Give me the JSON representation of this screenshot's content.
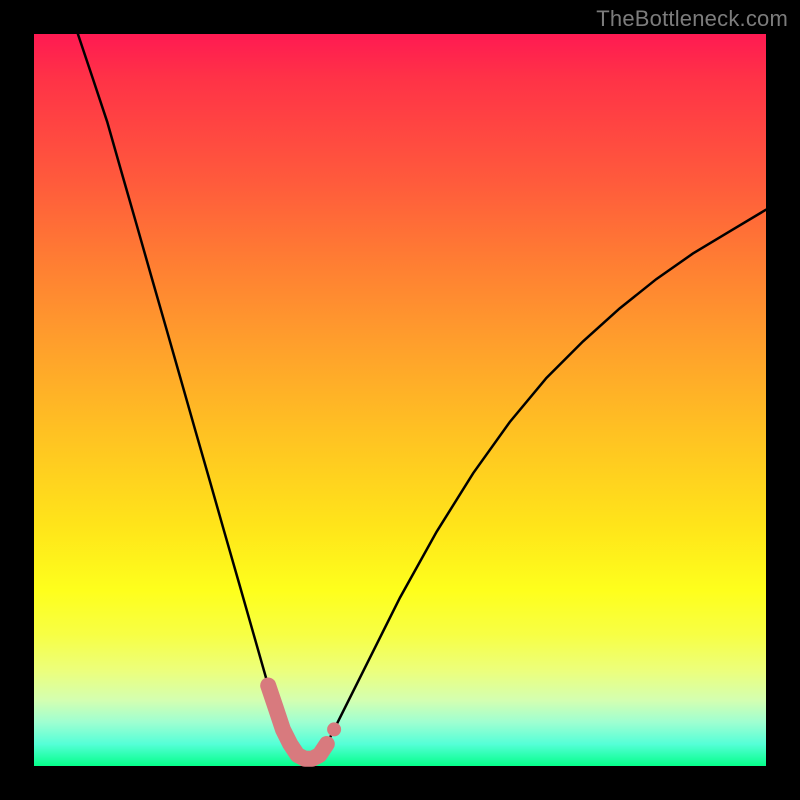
{
  "watermark": "TheBottleneck.com",
  "chart_data": {
    "type": "line",
    "title": "",
    "xlabel": "",
    "ylabel": "",
    "x_range": [
      0,
      100
    ],
    "y_range": [
      0,
      100
    ],
    "series": [
      {
        "name": "bottleneck-curve",
        "x": [
          6,
          8,
          10,
          12,
          14,
          16,
          18,
          20,
          22,
          24,
          26,
          28,
          30,
          32,
          33,
          34,
          35,
          36,
          37,
          38,
          39,
          40,
          42,
          45,
          50,
          55,
          60,
          65,
          70,
          75,
          80,
          85,
          90,
          95,
          100
        ],
        "y": [
          100,
          94,
          88,
          81,
          74,
          67,
          60,
          53,
          46,
          39,
          32,
          25,
          18,
          11,
          8,
          5,
          3,
          1.5,
          1,
          1,
          1.5,
          3,
          7,
          13,
          23,
          32,
          40,
          47,
          53,
          58,
          62.5,
          66.5,
          70,
          73,
          76
        ]
      }
    ],
    "highlight_segment": {
      "name": "valley-highlight",
      "color": "#d87a7e",
      "x": [
        32,
        33,
        34,
        35,
        36,
        37,
        38,
        39,
        40
      ],
      "y": [
        11,
        8,
        5,
        3,
        1.5,
        1,
        1,
        1.5,
        3
      ]
    },
    "gradient_stops": [
      {
        "pos": 0,
        "color": "#ff1a52"
      },
      {
        "pos": 20,
        "color": "#ff5a3c"
      },
      {
        "pos": 42,
        "color": "#ff9e2c"
      },
      {
        "pos": 67,
        "color": "#ffe41a"
      },
      {
        "pos": 82,
        "color": "#f7ff44"
      },
      {
        "pos": 94,
        "color": "#9fffd1"
      },
      {
        "pos": 100,
        "color": "#05ff8a"
      }
    ]
  }
}
